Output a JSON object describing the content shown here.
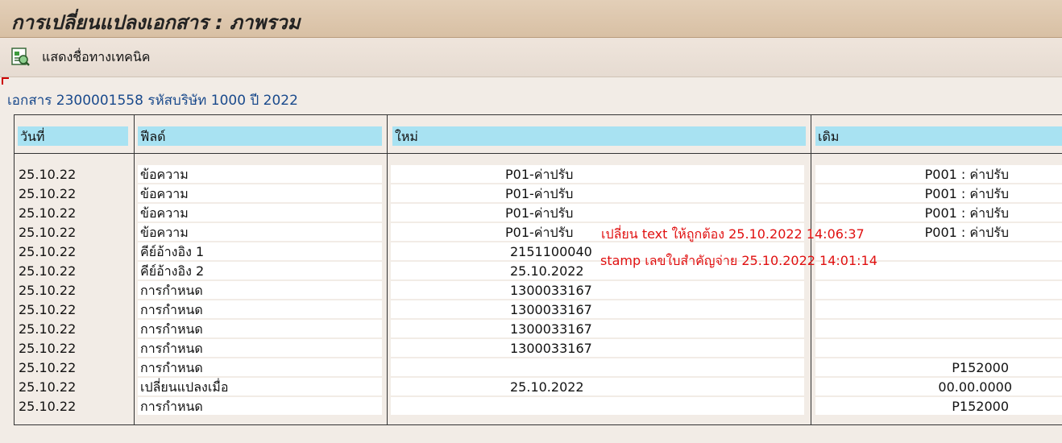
{
  "title": "การเปลี่ยนแปลงเอกสาร : ภาพรวม",
  "toolbar": {
    "tech_names_label": "แสดงชื่อทางเทคนิค"
  },
  "doc_header": "เอกสาร 2300001558 รหัสบริษัท 1000 ปี 2022",
  "columns": {
    "date": "วันที่",
    "field": "ฟีลด์",
    "new": "ใหม่",
    "old": "เดิม"
  },
  "rows": [
    {
      "date": "25.10.22",
      "field": "ข้อความ",
      "new": "P01-ค่าปรับ",
      "old": "P001 : ค่าปรับ"
    },
    {
      "date": "25.10.22",
      "field": "ข้อความ",
      "new": "P01-ค่าปรับ",
      "old": "P001 : ค่าปรับ"
    },
    {
      "date": "25.10.22",
      "field": "ข้อความ",
      "new": "P01-ค่าปรับ",
      "old": "P001 : ค่าปรับ"
    },
    {
      "date": "25.10.22",
      "field": "ข้อความ",
      "new": "P01-ค่าปรับ",
      "old": "P001 : ค่าปรับ"
    },
    {
      "date": "25.10.22",
      "field": "คีย์อ้างอิง 1",
      "new": "2151100040",
      "old": ""
    },
    {
      "date": "25.10.22",
      "field": "คีย์อ้างอิง 2",
      "new": "25.10.2022",
      "old": ""
    },
    {
      "date": "25.10.22",
      "field": "การกำหนด",
      "new": "1300033167",
      "old": ""
    },
    {
      "date": "25.10.22",
      "field": "การกำหนด",
      "new": "1300033167",
      "old": ""
    },
    {
      "date": "25.10.22",
      "field": "การกำหนด",
      "new": "1300033167",
      "old": ""
    },
    {
      "date": "25.10.22",
      "field": "การกำหนด",
      "new": "1300033167",
      "old": ""
    },
    {
      "date": "25.10.22",
      "field": "การกำหนด",
      "new": "",
      "old": "P152000"
    },
    {
      "date": "25.10.22",
      "field": "เปลี่ยนแปลงเมื่อ",
      "new": "25.10.2022",
      "old": "00.00.0000"
    },
    {
      "date": "25.10.22",
      "field": "การกำหนด",
      "new": "",
      "old": "P152000"
    }
  ],
  "annotations": {
    "note1": "เปลี่ยน text ให้ถูกต้อง 25.10.2022 14:06:37",
    "note2": "stamp เลขใบสำคัญจ่าย 25.10.2022 14:01:14"
  },
  "colors": {
    "header_cell": "#a8e2f2",
    "annotation": "#e01010",
    "doc_header": "#1a4a8c"
  },
  "icons": {
    "toolbar_button": "technical-names-icon"
  }
}
